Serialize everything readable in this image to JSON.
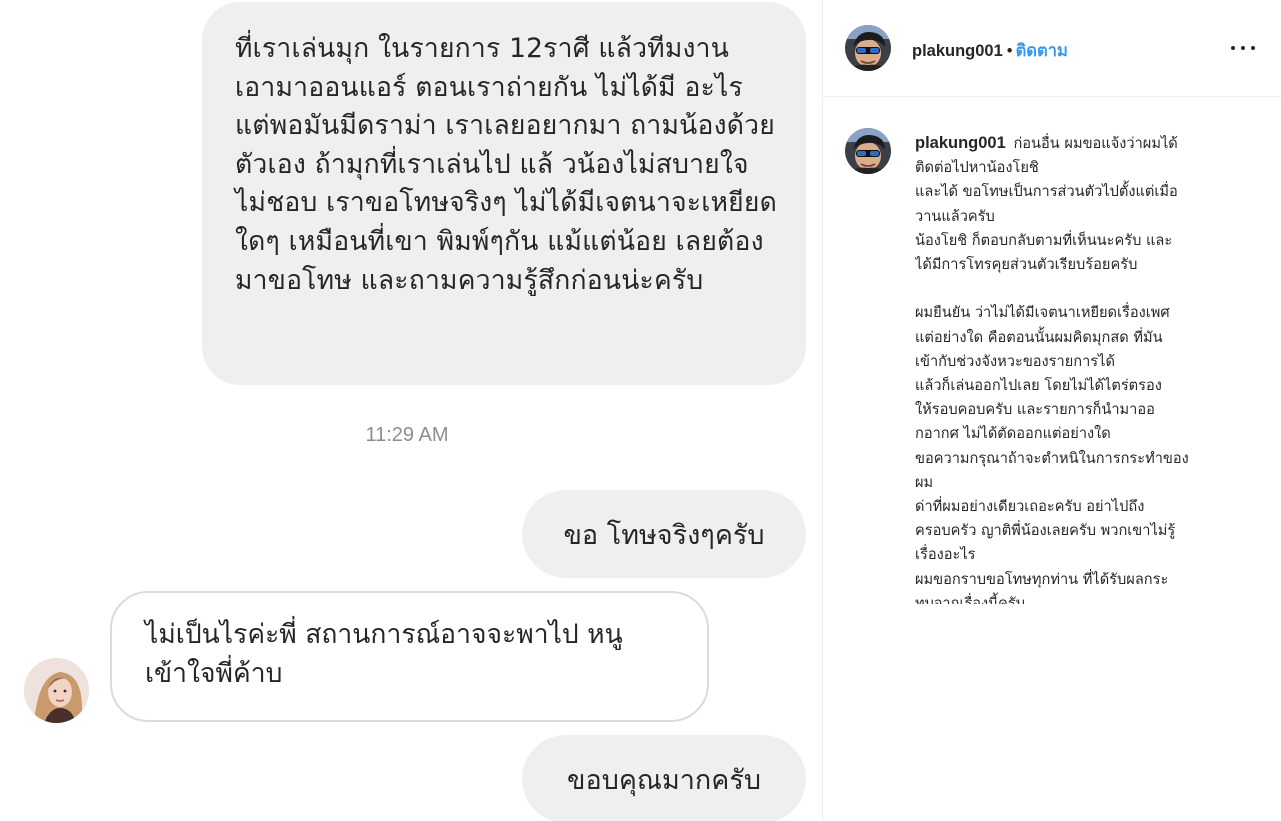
{
  "chat": {
    "messages": [
      {
        "from": "me",
        "lines": [
          "ที่เราเล่นมุก ในรายการ 12ราศี แล้วทีมงาน",
          "เอามาออนแอร์ ตอนเราถ่ายกัน ไม่ได้มี",
          "อะไร แต่พอมันมีดราม่า เราเลยอยากมา",
          "ถามน้องด้วยตัวเอง ถ้ามุกที่เราเล่นไป แล้",
          "วน้องไม่สบายใจ ไม่ชอบ เราขอโทษจริงๆ",
          "ไม่ได้มีเจตนาจะเหยียดใดๆ เหมือนที่เขา",
          "พิมพ์ๆกัน แม้แต่น้อย เลยต้องมาขอโทษ",
          "และถามความรู้สึกก่อนน่ะครับ"
        ]
      },
      {
        "from": "me",
        "text": "ขอ โทษจริงๆครับ"
      },
      {
        "from": "other",
        "lines": [
          "ไม่เป็นไรค่ะพี่ สถานการณ์อาจจะพาไป หนู",
          "เข้าใจพี่ค้าบ"
        ]
      },
      {
        "from": "me",
        "text": "ขอบคุณมากครับ"
      }
    ],
    "timestamp": "11:29 AM"
  },
  "post": {
    "header": {
      "username": "plakung001",
      "separator": "•",
      "follow_label": "ติดตาม",
      "more_icon": "more-options-icon"
    },
    "caption": {
      "username": "plakung001",
      "lines": [
        "ก่อนอื่น ผมขอแจ้งว่าผมได้",
        "ติดต่อไปหาน้องโยชิ",
        "และได้ ขอโทษเป็นการส่วนตัวไปตั้งแต่เมื่อ",
        "วานแล้วครับ",
        "น้องโยชิ ก็ตอบกลับตามที่เห็นนะครับ และ",
        "ได้มีการโทรคุยส่วนตัวเรียบร้อยครับ",
        "",
        "ผมยืนยัน ว่าไม่ได้มีเจตนาเหยียดเรื่องเพศ",
        "แต่อย่างใด คือตอนนั้นผมคิดมุกสด ที่มัน",
        "เข้ากับช่วงจังหวะของรายการได้",
        "แล้วก็เล่นออกไปเลย โดยไม่ได้ไตร่ตรอง",
        "ให้รอบคอบครับ และรายการก็นำมาออ",
        "กอากศ ไม่ได้ตัดออกแต่อย่างใด",
        "ขอความกรุณาถ้าจะตำหนิในการกระทำของ",
        "ผม",
        "ด่าที่ผมอย่างเดียวเถอะครับ อย่าไปถึง",
        "ครอบครัว ญาติพี่น้องเลยครับ พวกเขาไม่รู้",
        "เรื่องอะไร",
        "ผมขอกราบขอโทษทุกท่าน ที่ได้รับผลกระ",
        "ทบจากเรื่องนี้ครับ"
      ]
    }
  },
  "colors": {
    "bubble_outgoing": "#efefef",
    "bubble_incoming_border": "#dbdbdb",
    "follow_link": "#3897f0",
    "timestamp": "#8e8e8e"
  }
}
